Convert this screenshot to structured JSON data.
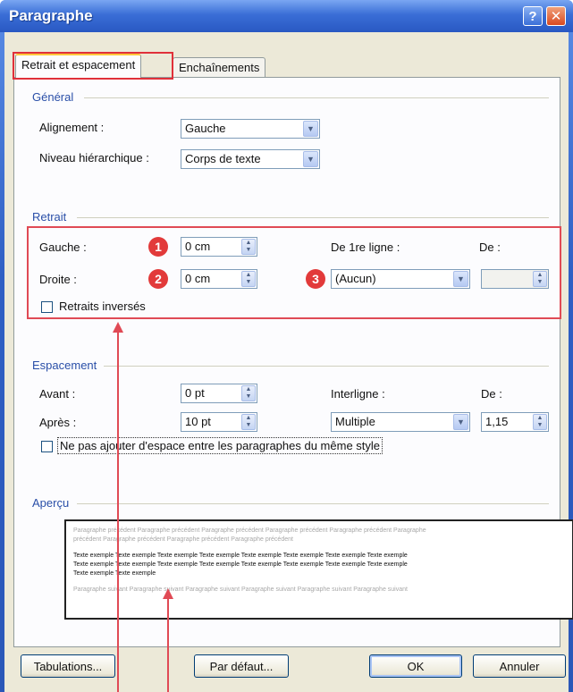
{
  "window": {
    "title": "Paragraphe",
    "help_label": "?",
    "close_label": "✕"
  },
  "tabs": [
    {
      "label": "Retrait et espacement",
      "active": true
    },
    {
      "label": "Enchaînements",
      "active": false
    }
  ],
  "general": {
    "title": "Général",
    "alignment_label": "Alignement :",
    "alignment_value": "Gauche",
    "level_label": "Niveau hiérarchique :",
    "level_value": "Corps de texte"
  },
  "indent": {
    "title": "Retrait",
    "left_label": "Gauche :",
    "left_value": "0 cm",
    "right_label": "Droite :",
    "right_value": "0 cm",
    "first_line_label": "De 1re ligne :",
    "first_line_value": "(Aucun)",
    "by_label": "De :",
    "by_value": "",
    "mirror_label": "Retraits inversés",
    "badges": [
      "1",
      "2",
      "3"
    ]
  },
  "spacing": {
    "title": "Espacement",
    "before_label": "Avant :",
    "before_value": "0 pt",
    "after_label": "Après :",
    "after_value": "10 pt",
    "line_spacing_label": "Interligne :",
    "line_spacing_value": "Multiple",
    "at_label": "De :",
    "at_value": "1,15",
    "no_space_label": "Ne pas ajouter d'espace entre les paragraphes du même style"
  },
  "preview": {
    "title": "Aperçu",
    "prev_lines": [
      "Paragraphe précédent Paragraphe précédent Paragraphe précédent Paragraphe précédent Paragraphe précédent Paragraphe",
      "précédent Paragraphe précédent Paragraphe précédent Paragraphe précédent"
    ],
    "sample_lines": [
      "Texte exemple Texte exemple Texte exemple Texte exemple Texte exemple Texte exemple Texte exemple Texte exemple",
      "Texte exemple Texte exemple Texte exemple Texte exemple Texte exemple Texte exemple Texte exemple Texte exemple",
      "Texte exemple Texte exemple"
    ],
    "next_lines": [
      "Paragraphe suivant Paragraphe suivant Paragraphe suivant Paragraphe suivant Paragraphe suivant Paragraphe suivant"
    ]
  },
  "buttons": {
    "tabs_label": "Tabulations...",
    "default_label": "Par défaut...",
    "ok_label": "OK",
    "cancel_label": "Annuler"
  }
}
